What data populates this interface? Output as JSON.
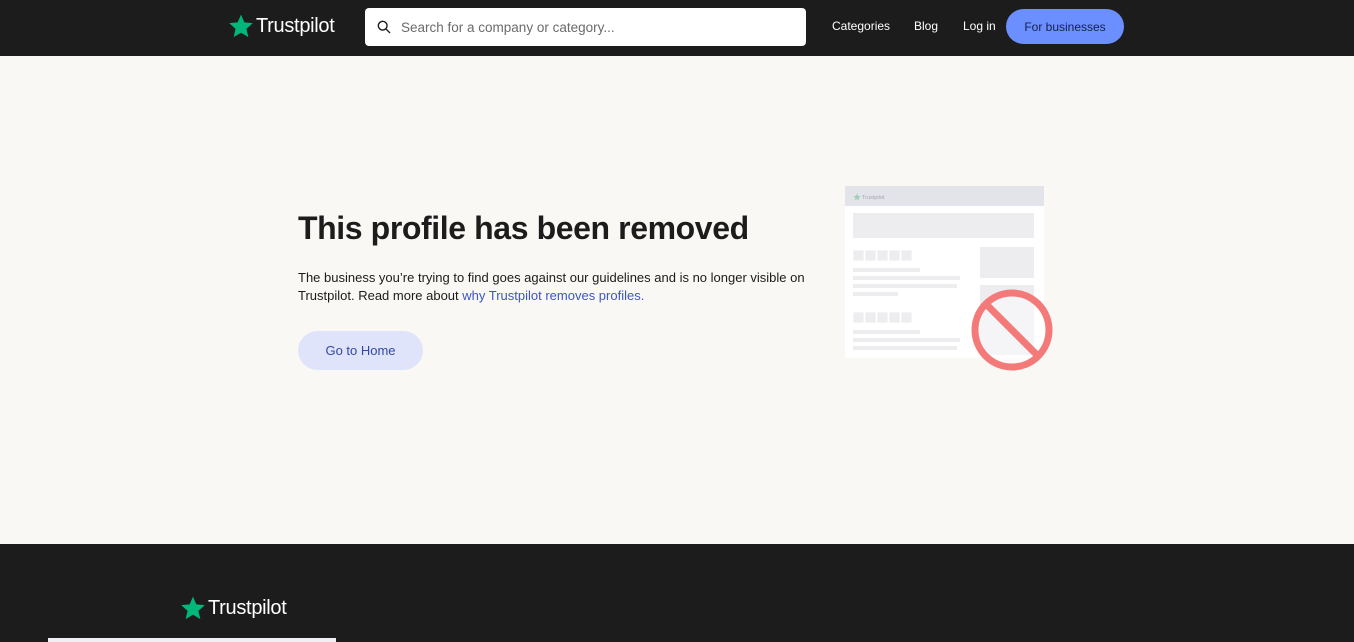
{
  "header": {
    "logo_text": "Trustpilot",
    "search": {
      "placeholder": "Search for a company or category...",
      "value": ""
    },
    "nav": {
      "categories": "Categories",
      "blog": "Blog",
      "login": "Log in"
    },
    "business_button": "For businesses"
  },
  "main": {
    "title": "This profile has been removed",
    "description_prefix": "The business you’re trying to find goes against our guidelines and is no longer visible on Trustpilot. Read more about ",
    "description_link": "why Trustpilot removes profiles.",
    "home_button": "Go to Home",
    "illustration_logo": "Trustpilot"
  },
  "footer": {
    "logo_text": "Trustpilot"
  },
  "colors": {
    "brand_green": "#00b67a",
    "header_bg": "#1c1c1c",
    "page_bg": "#faf8f5",
    "business_button": "#6c8fff",
    "link": "#3b56c7",
    "home_button_bg": "#dfe4fa",
    "prohibited_red": "#f47a7a"
  }
}
